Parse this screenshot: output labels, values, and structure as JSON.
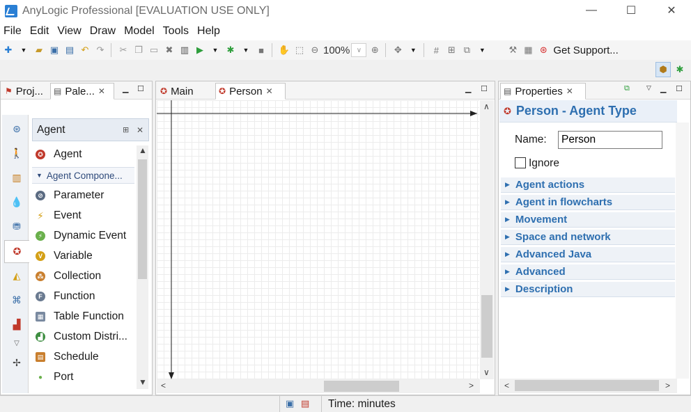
{
  "window": {
    "title": "AnyLogic Professional [EVALUATION USE ONLY]",
    "minimize_label": "—",
    "maximize_label": "☐",
    "close_label": "✕"
  },
  "menu": [
    "File",
    "Edit",
    "View",
    "Draw",
    "Model",
    "Tools",
    "Help"
  ],
  "toolbar": {
    "zoom_value": "100%",
    "get_support_label": "Get Support..."
  },
  "left_panel": {
    "tab_projects": "Proj...",
    "tab_palette": "Pale...",
    "palette_header": "Agent",
    "items": [
      "Agent",
      "Agent Compone...",
      "Parameter",
      "Event",
      "Dynamic Event",
      "Variable",
      "Collection",
      "Function",
      "Table Function",
      "Custom Distri...",
      "Schedule",
      "Port"
    ]
  },
  "editor": {
    "tab_main": "Main",
    "tab_person": "Person"
  },
  "properties": {
    "tab_label": "Properties",
    "title": "Person - Agent Type",
    "name_label": "Name:",
    "name_value": "Person",
    "ignore_label": "Ignore",
    "sections": [
      "Agent actions",
      "Agent in flowcharts",
      "Movement",
      "Space and network",
      "Advanced Java",
      "Advanced",
      "Description"
    ]
  },
  "status": {
    "time_units": "Time: minutes"
  },
  "colors": {
    "accent": "#2e6fb0",
    "agent_red": "#c0392b"
  }
}
